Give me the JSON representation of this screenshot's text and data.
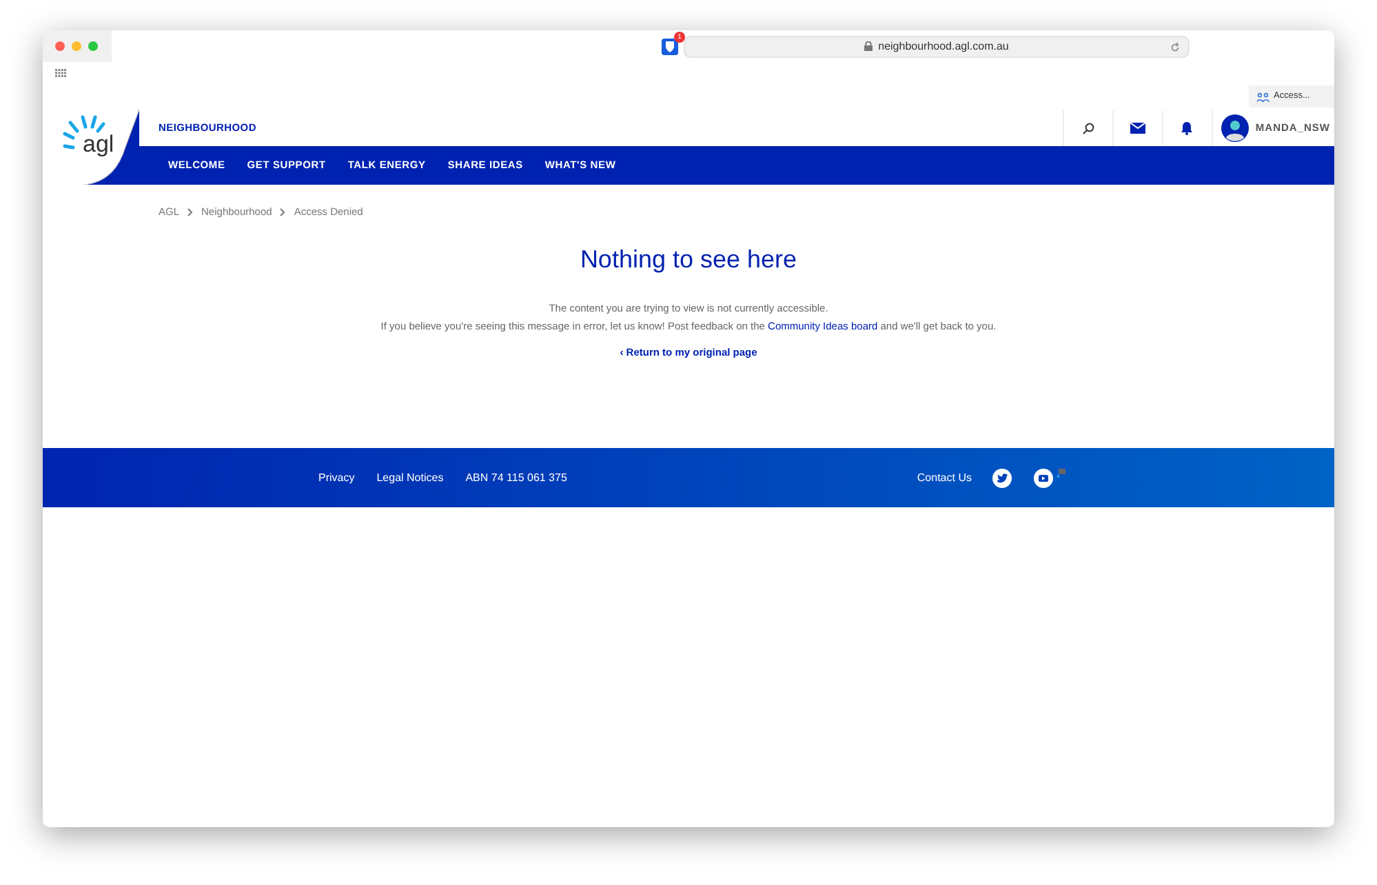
{
  "browser": {
    "url": "neighbourhood.agl.com.au",
    "extension_badge": "1",
    "access_label": "Access..."
  },
  "header": {
    "logo_text": "agl",
    "section": "NEIGHBOURHOOD",
    "username": "MANDA_NSW"
  },
  "nav": [
    {
      "label": "WELCOME"
    },
    {
      "label": "GET SUPPORT"
    },
    {
      "label": "TALK ENERGY"
    },
    {
      "label": "SHARE IDEAS"
    },
    {
      "label": "WHAT'S NEW"
    }
  ],
  "breadcrumb": [
    "AGL",
    "Neighbourhood",
    "Access Denied"
  ],
  "heading": "Nothing to see here",
  "message_1": "The content you are trying to view is not currently accessible.",
  "message_2": {
    "before": "If you believe you're seeing this message in error, let us know! Post feedback on the ",
    "link": "Community Ideas board",
    "after": " and we'll get back to you."
  },
  "return_link": "‹ Return to my original page",
  "footer": {
    "links": [
      "Privacy",
      "Legal Notices",
      "ABN 74 115 061 375"
    ],
    "contact": "Contact Us"
  }
}
